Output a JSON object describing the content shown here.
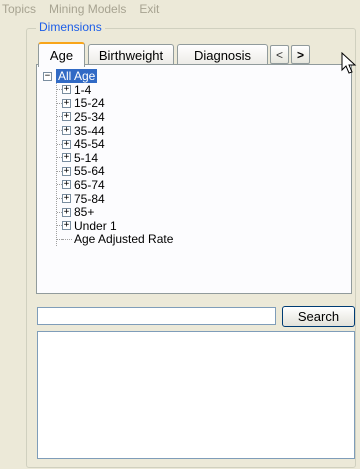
{
  "menu": {
    "items": [
      "Topics",
      "Mining Models",
      "Exit"
    ]
  },
  "dimensions": {
    "title": "Dimensions",
    "tabs": [
      "Age",
      "Birthweight",
      "Diagnosis"
    ],
    "active_tab": "Age",
    "prev_tab_glyph": "<",
    "next_tab_glyph": ">"
  },
  "tree": {
    "root": "All Age",
    "children": [
      {
        "label": "1-4",
        "expandable": true
      },
      {
        "label": "15-24",
        "expandable": true
      },
      {
        "label": "25-34",
        "expandable": true
      },
      {
        "label": "35-44",
        "expandable": true
      },
      {
        "label": "45-54",
        "expandable": true
      },
      {
        "label": "5-14",
        "expandable": true
      },
      {
        "label": "55-64",
        "expandable": true
      },
      {
        "label": "65-74",
        "expandable": true
      },
      {
        "label": "75-84",
        "expandable": true
      },
      {
        "label": "85+",
        "expandable": true
      },
      {
        "label": "Under 1",
        "expandable": true
      },
      {
        "label": "Age Adjusted Rate",
        "expandable": false
      }
    ]
  },
  "search": {
    "value": "",
    "button_label": "Search"
  },
  "colors": {
    "window_bg": "#ece9d8",
    "selection": "#316ac5",
    "group_title": "#1d5ee8",
    "active_tab_accent": "#f8a51a"
  }
}
